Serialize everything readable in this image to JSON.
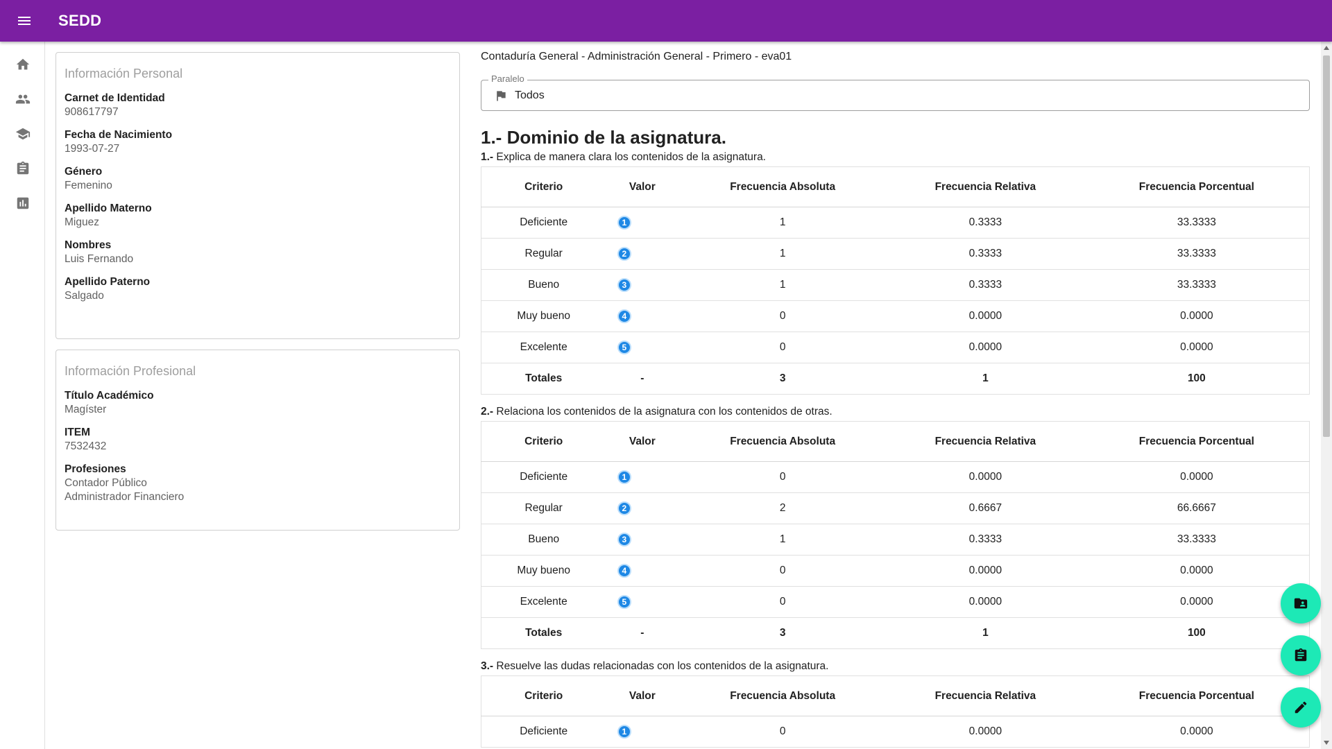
{
  "app": {
    "title": "SEDD"
  },
  "rail": [
    "home-icon",
    "people-icon",
    "school-icon",
    "assignment-icon",
    "bar-chart-icon"
  ],
  "personal": {
    "title": "Información Personal",
    "fields": [
      {
        "label": "Carnet de Identidad",
        "value": "908617797"
      },
      {
        "label": "Fecha de Nacimiento",
        "value": "1993-07-27"
      },
      {
        "label": "Género",
        "value": "Femenino"
      },
      {
        "label": "Apellido Materno",
        "value": "Miguez"
      },
      {
        "label": "Nombres",
        "value": "Luis Fernando"
      },
      {
        "label": "Apellido Paterno",
        "value": "Salgado"
      }
    ]
  },
  "professional": {
    "title": "Información Profesional",
    "fields": [
      {
        "label": "Título Académico",
        "value": "Magíster"
      },
      {
        "label": "ITEM",
        "value": "7532432"
      }
    ],
    "professions_label": "Profesiones",
    "professions": [
      "Contador Público",
      "Administrador Financiero"
    ]
  },
  "main": {
    "breadcrumb": "Contaduría General - Administración General - Primero - eva01",
    "select": {
      "legend": "Paralelo",
      "value": "Todos"
    },
    "section_title": "1.- Dominio de la asignatura.",
    "headers": [
      "Criterio",
      "Valor",
      "Frecuencia Absoluta",
      "Frecuencia Relativa",
      "Frecuencia Porcentual"
    ],
    "questions": [
      {
        "num": "1.-",
        "text": " Explica de manera clara los contenidos de la asignatura.",
        "rows": [
          [
            "Deficiente",
            "1",
            "1",
            "0.3333",
            "33.3333"
          ],
          [
            "Regular",
            "2",
            "1",
            "0.3333",
            "33.3333"
          ],
          [
            "Bueno",
            "3",
            "1",
            "0.3333",
            "33.3333"
          ],
          [
            "Muy bueno",
            "4",
            "0",
            "0.0000",
            "0.0000"
          ],
          [
            "Excelente",
            "5",
            "0",
            "0.0000",
            "0.0000"
          ]
        ],
        "totals": [
          "Totales",
          "-",
          "3",
          "1",
          "100"
        ]
      },
      {
        "num": "2.-",
        "text": " Relaciona los contenidos de la asignatura con los contenidos de otras.",
        "rows": [
          [
            "Deficiente",
            "1",
            "0",
            "0.0000",
            "0.0000"
          ],
          [
            "Regular",
            "2",
            "2",
            "0.6667",
            "66.6667"
          ],
          [
            "Bueno",
            "3",
            "1",
            "0.3333",
            "33.3333"
          ],
          [
            "Muy bueno",
            "4",
            "0",
            "0.0000",
            "0.0000"
          ],
          [
            "Excelente",
            "5",
            "0",
            "0.0000",
            "0.0000"
          ]
        ],
        "totals": [
          "Totales",
          "-",
          "3",
          "1",
          "100"
        ]
      },
      {
        "num": "3.-",
        "text": " Resuelve las dudas relacionadas con los contenidos de la asignatura.",
        "rows": [
          [
            "Deficiente",
            "1",
            "0",
            "0.0000",
            "0.0000"
          ]
        ],
        "totals": null
      }
    ]
  },
  "fabs": [
    "folder-shared-icon",
    "assignment-icon",
    "edit-icon"
  ]
}
